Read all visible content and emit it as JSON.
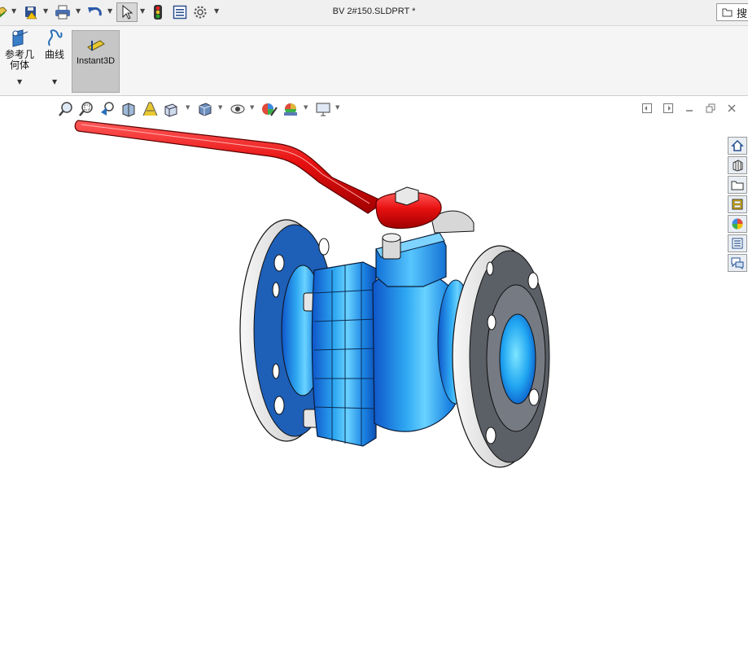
{
  "window": {
    "title": "BV 2#150.SLDPRT *"
  },
  "search": {
    "label": "搜"
  },
  "ribbon": {
    "ref_geometry_label_line1": "参考几",
    "ref_geometry_label_line2": "何体",
    "curves_label": "曲线",
    "instant3d_label": "Instant3D"
  },
  "colors": {
    "handle": "#e01010",
    "body": "#1a8fe8",
    "flange_face": "#1e5fb8",
    "flange_rim": "#e9e9e9",
    "flange_right_face": "#5b5f66",
    "active_tool": "#c6c6c6"
  },
  "icons": {
    "quick_access": [
      "open-icon",
      "save-icon",
      "print-icon",
      "undo-icon",
      "select-icon",
      "rebuild-icon",
      "file-properties-icon",
      "options-icon"
    ],
    "heads_up": [
      "zoom-to-fit-icon",
      "zoom-to-area-icon",
      "previous-view-icon",
      "section-view-icon",
      "dynamic-annotation-icon",
      "view-orientation-icon",
      "display-style-icon",
      "hide-show-icon",
      "edit-appearance-icon",
      "apply-scene-icon",
      "view-settings-icon"
    ],
    "task_pane": [
      "home-icon",
      "design-library-icon",
      "file-explorer-icon",
      "view-palette-icon",
      "appearances-icon",
      "custom-properties-icon",
      "forum-icon"
    ]
  }
}
